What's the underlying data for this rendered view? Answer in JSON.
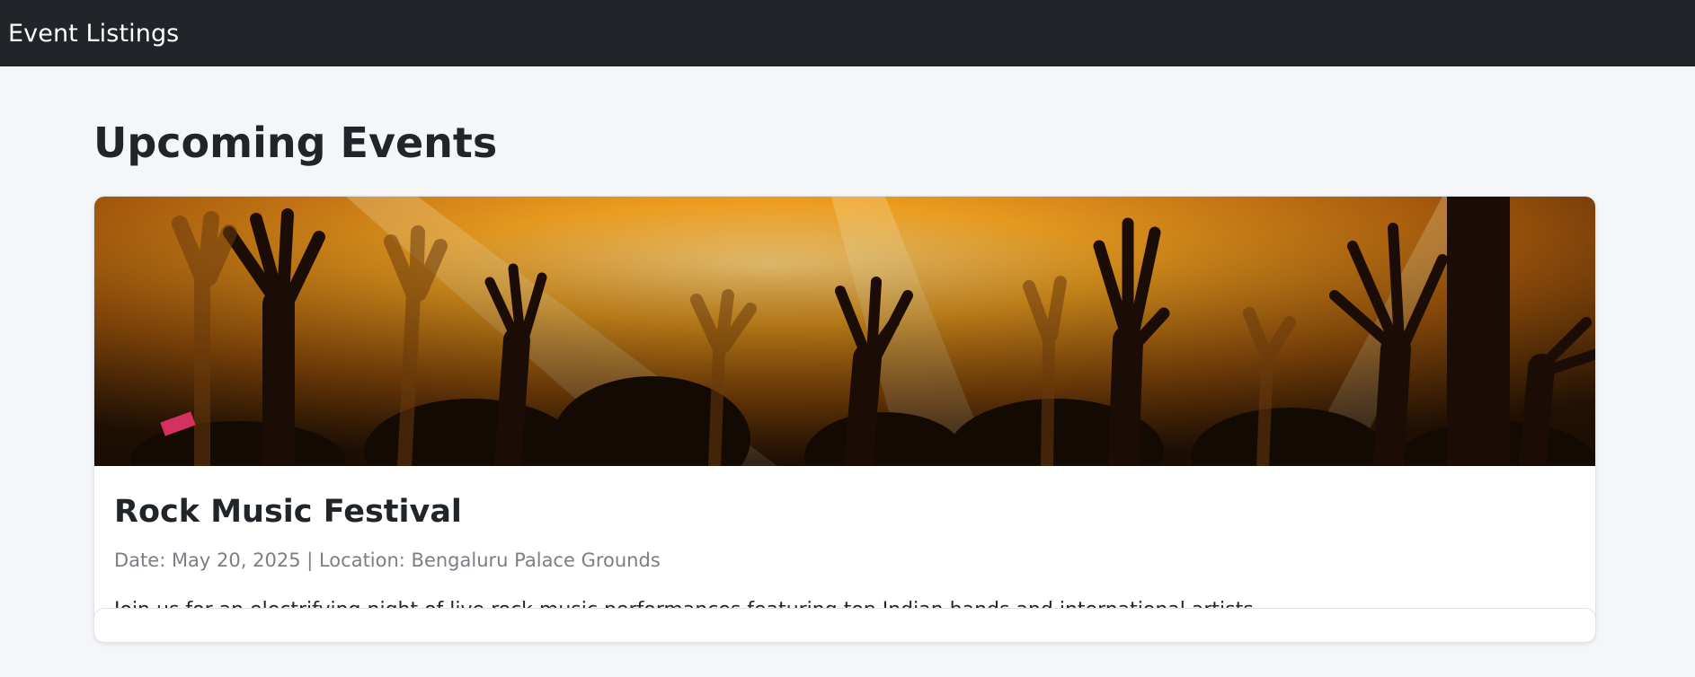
{
  "navbar": {
    "brand": "Event Listings"
  },
  "main": {
    "heading": "Upcoming Events",
    "events": [
      {
        "title": "Rock Music Festival",
        "meta": "Date: May 20, 2025 | Location: Bengaluru Palace Grounds",
        "description": "Join us for an electrifying night of live rock music performances featuring top Indian bands and international artists.",
        "image": "concert-crowd-hands-image"
      }
    ]
  },
  "colors": {
    "navbar_bg": "#212529",
    "page_bg": "#f5f6fa",
    "card_bg": "#ffffff",
    "meta_text": "#7a7f86",
    "image_glow": "#f0a020"
  }
}
